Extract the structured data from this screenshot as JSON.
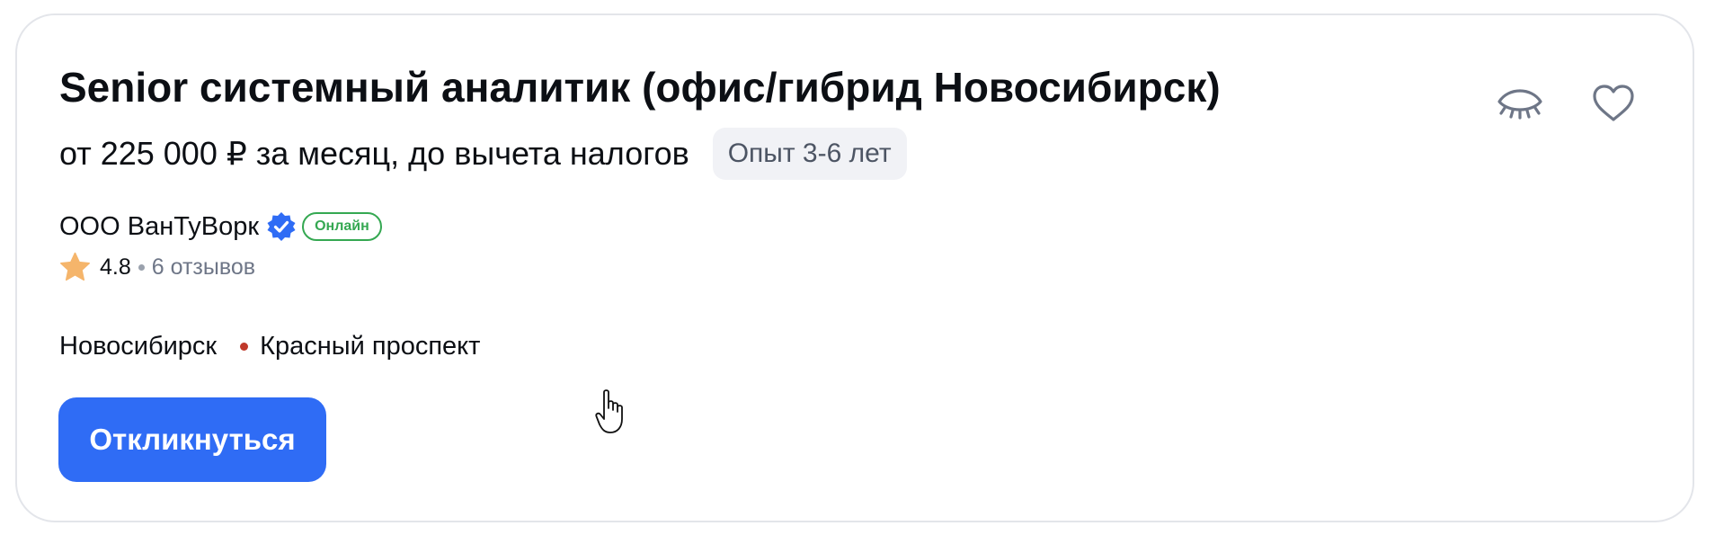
{
  "vacancy": {
    "title": "Senior системный аналитик (офис/гибрид Новосибирск)",
    "salary": "от 225 000 ₽ за месяц, до вычета налогов",
    "experience": "Опыт 3-6 лет"
  },
  "company": {
    "name": "ООО ВанТуВорк",
    "online_badge": "Онлайн",
    "rating": "4.8",
    "reviews": "6 отзывов"
  },
  "location": {
    "city": "Новосибирск",
    "metro": "Красный проспект"
  },
  "actions": {
    "apply_label": "Откликнуться",
    "hide_icon": "eye-closed-icon",
    "favorite_icon": "heart-icon"
  },
  "colors": {
    "accent": "#2f6cf5",
    "online": "#35a852",
    "star": "#f5b56b",
    "metro": "#c0392b"
  }
}
